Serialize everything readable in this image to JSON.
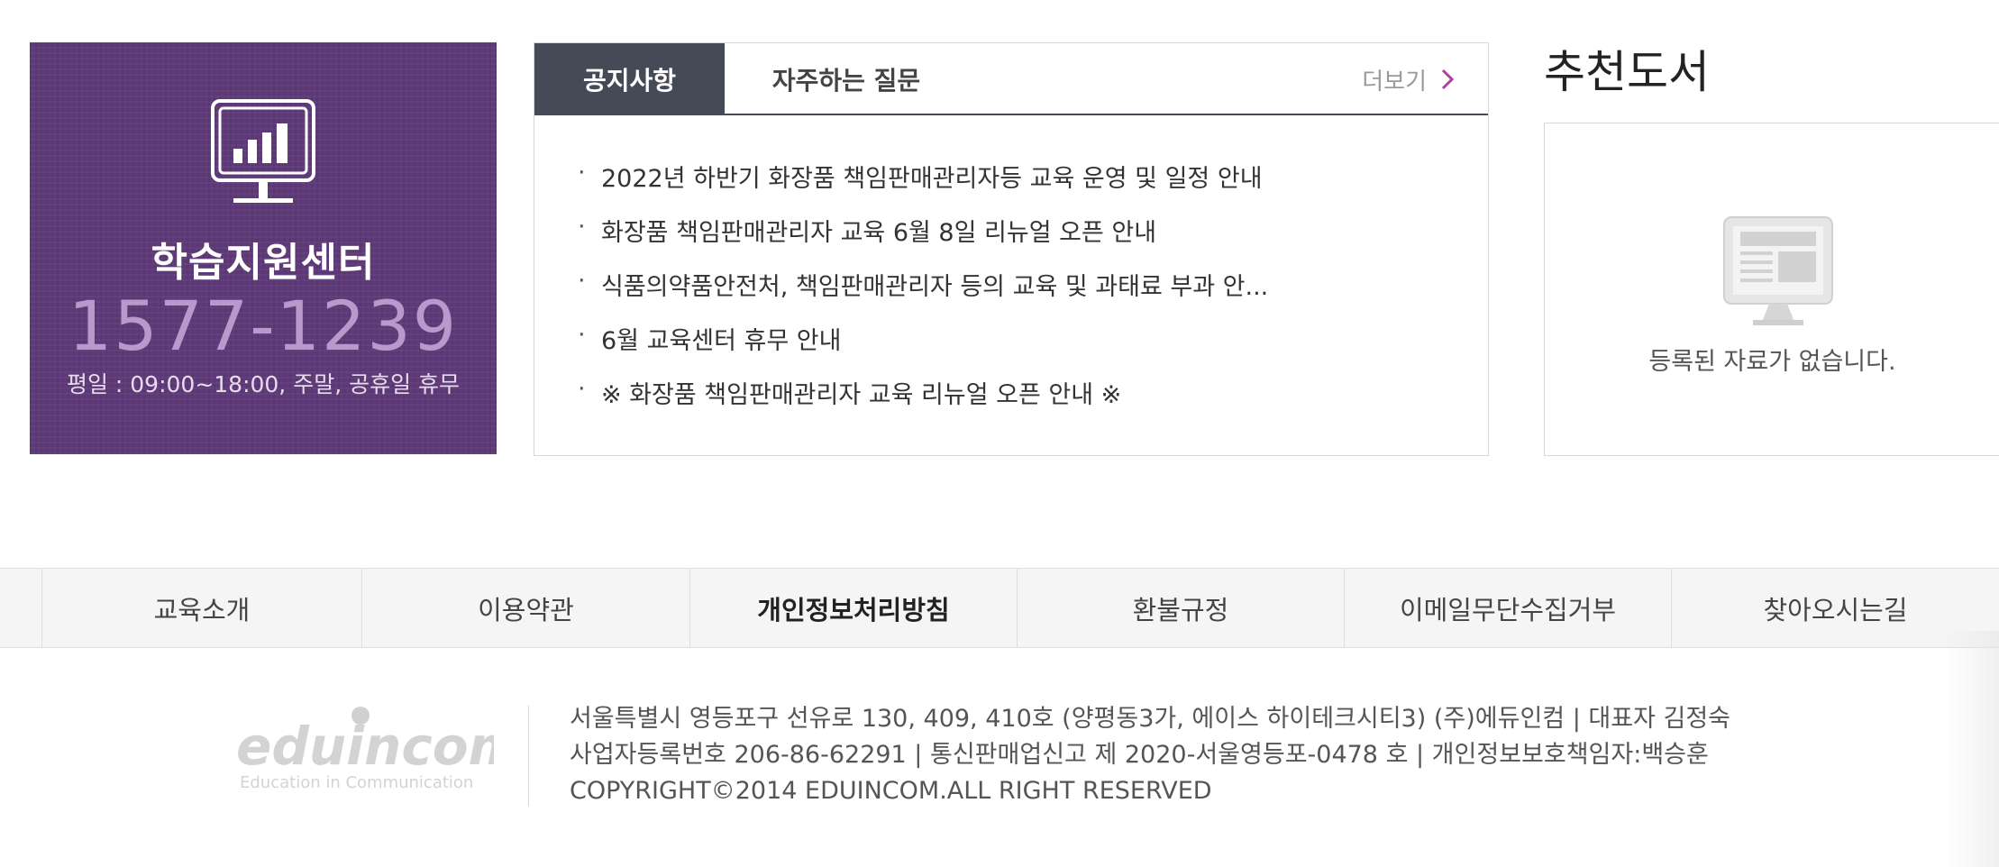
{
  "support_center": {
    "icon": "monitor-chart-icon",
    "title": "학습지원센터",
    "phone": "1577-1239",
    "hours": "평일 : 09:00~18:00, 주말, 공휴일 휴무",
    "bg_color": "#5f3a78"
  },
  "notice": {
    "tabs": [
      {
        "label": "공지사항",
        "active": true
      },
      {
        "label": "자주하는 질문",
        "active": false
      }
    ],
    "more_label": "더보기",
    "more_icon": "chevron-right-icon",
    "items": [
      "2022년 하반기 화장품 책임판매관리자등 교육 운영 및 일정 안내",
      "화장품 책임판매관리자 교육 6월 8일 리뉴얼 오픈 안내",
      "식품의약품안전처, 책임판매관리자 등의 교육 및 과태료 부과 안...",
      "6월 교육센터 휴무 안내",
      "※ 화장품 책임판매관리자 교육 리뉴얼 오픈 안내 ※"
    ],
    "bullet": "·"
  },
  "recommended": {
    "title": "추천도서",
    "empty_icon": "empty-monitor-icon",
    "empty_text": "등록된 자료가 없습니다."
  },
  "footer_nav": [
    {
      "label": "교육소개",
      "bold": false
    },
    {
      "label": "이용약관",
      "bold": false
    },
    {
      "label": "개인정보처리방침",
      "bold": true
    },
    {
      "label": "환불규정",
      "bold": false
    },
    {
      "label": "이메일무단수집거부",
      "bold": false
    },
    {
      "label": "찾아오시는길",
      "bold": false
    }
  ],
  "footer": {
    "logo_text": "eduincom",
    "logo_tagline": "Education in Communication",
    "address": "서울특별시 영등포구 선유로 130, 409, 410호 (양평동3가, 에이스 하이테크시티3) (주)에듀인컴 | 대표자 김정숙",
    "registration": "사업자등록번호 206-86-62291 | 통신판매업신고 제 2020-서울영등포-0478 호 | 개인정보보호책임자:백승훈",
    "copyright": "COPYRIGHT©2014 EDUINCOM.ALL RIGHT RESERVED"
  }
}
